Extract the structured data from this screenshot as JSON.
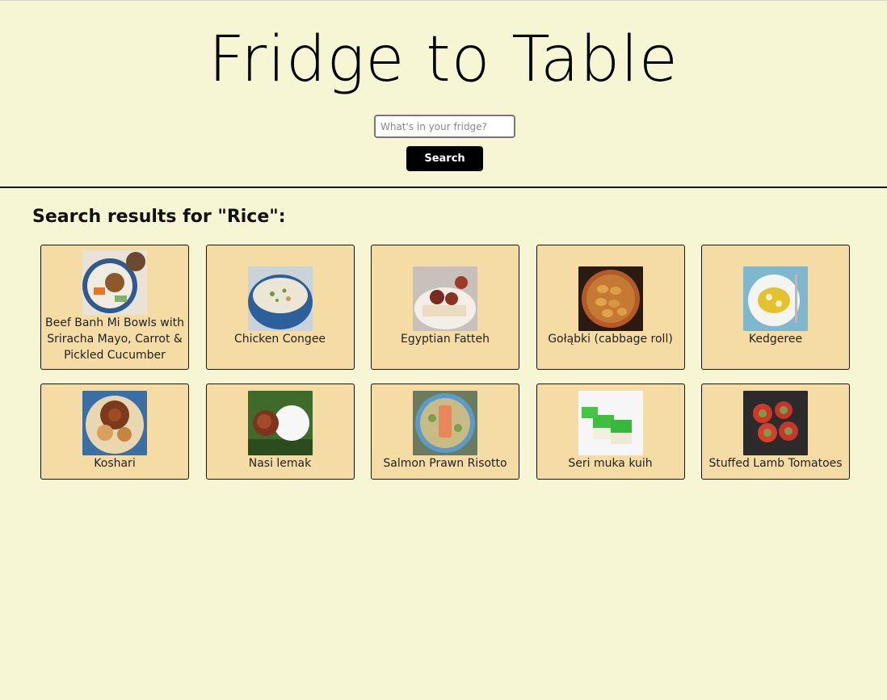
{
  "app": {
    "title": "Fridge to Table"
  },
  "search": {
    "placeholder": "What's in your fridge?",
    "value": "",
    "button_label": "Search"
  },
  "results": {
    "heading": "Search results for \"Rice\":",
    "items": [
      {
        "name": "Beef Banh Mi Bowls with Sriracha Mayo, Carrot & Pickled Cucumber",
        "icon": "beef-banh-mi-bowl-photo"
      },
      {
        "name": "Chicken Congee",
        "icon": "chicken-congee-photo"
      },
      {
        "name": "Egyptian Fatteh",
        "icon": "egyptian-fatteh-photo"
      },
      {
        "name": "Gołąbki (cabbage roll)",
        "icon": "golabki-photo"
      },
      {
        "name": "Kedgeree",
        "icon": "kedgeree-photo"
      },
      {
        "name": "Koshari",
        "icon": "koshari-photo"
      },
      {
        "name": "Nasi lemak",
        "icon": "nasi-lemak-photo"
      },
      {
        "name": "Salmon Prawn Risotto",
        "icon": "salmon-prawn-risotto-photo"
      },
      {
        "name": "Seri muka kuih",
        "icon": "seri-muka-kuih-photo"
      },
      {
        "name": "Stuffed Lamb Tomatoes",
        "icon": "stuffed-lamb-tomatoes-photo"
      }
    ]
  },
  "colors": {
    "page_background": "#f6f6d5",
    "card_background": "#f4dca4",
    "button_background": "#000000"
  }
}
